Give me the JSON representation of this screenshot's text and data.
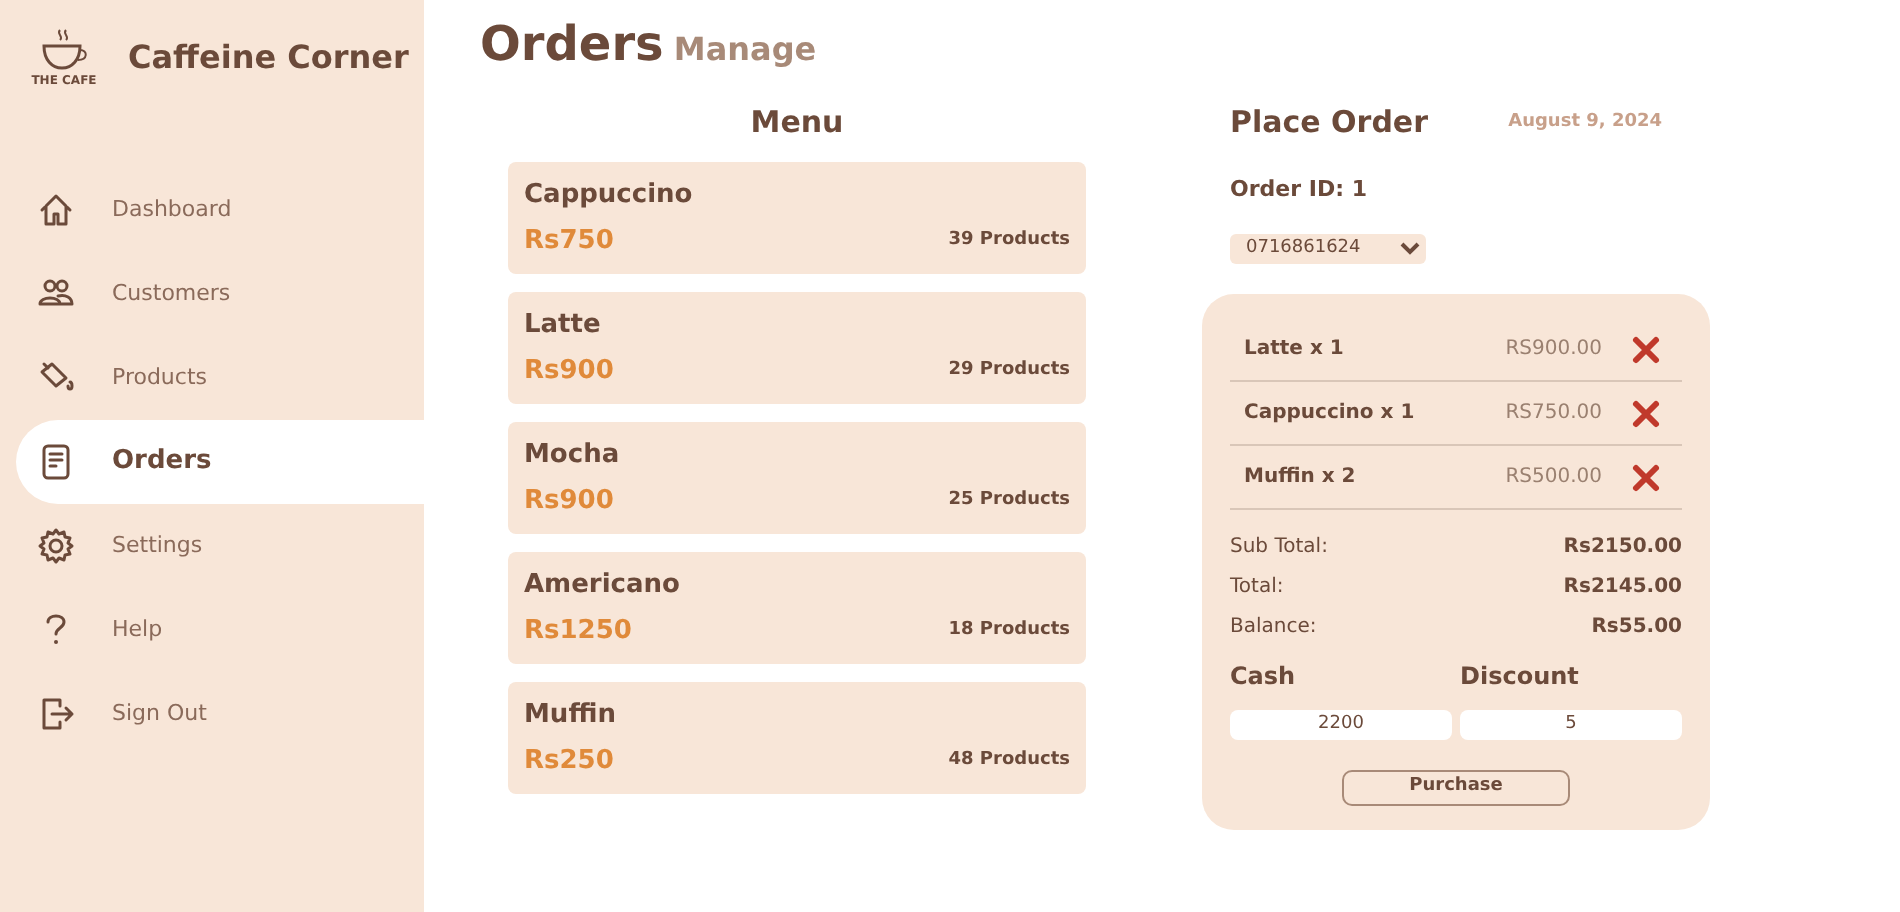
{
  "brand": {
    "logo_text": "THE CAFE",
    "name": "Caffeine Corner"
  },
  "sidebar": {
    "items": [
      {
        "label": "Dashboard",
        "selected": false
      },
      {
        "label": "Customers",
        "selected": false
      },
      {
        "label": "Products",
        "selected": false
      },
      {
        "label": "Orders",
        "selected": true
      },
      {
        "label": "Settings",
        "selected": false
      },
      {
        "label": "Help",
        "selected": false
      },
      {
        "label": "Sign Out",
        "selected": false
      }
    ]
  },
  "page": {
    "title": "Orders",
    "subtitle": "Manage"
  },
  "menu": {
    "heading": "Menu",
    "items": [
      {
        "name": "Cappuccino",
        "price": "Rs750",
        "stock": "39 Products"
      },
      {
        "name": "Latte",
        "price": "Rs900",
        "stock": "29 Products"
      },
      {
        "name": "Mocha",
        "price": "Rs900",
        "stock": "25 Products"
      },
      {
        "name": "Americano",
        "price": "Rs1250",
        "stock": "18 Products"
      },
      {
        "name": "Muffin",
        "price": "Rs250",
        "stock": "48 Products"
      }
    ]
  },
  "order": {
    "heading": "Place Order",
    "date": "August 9, 2024",
    "order_id": "Order ID: 1",
    "customer": "0716861624",
    "lines": [
      {
        "item": "Latte x 1",
        "amount": "RS900.00"
      },
      {
        "item": "Cappuccino x 1",
        "amount": "RS750.00"
      },
      {
        "item": "Muffin x 2",
        "amount": "RS500.00"
      }
    ],
    "totals": [
      {
        "label": "Sub Total:",
        "value": "Rs2150.00"
      },
      {
        "label": "Total:",
        "value": "Rs2145.00"
      },
      {
        "label": "Balance:",
        "value": "Rs55.00"
      }
    ],
    "cash": {
      "label": "Cash",
      "value": "2200"
    },
    "discount": {
      "label": "Discount",
      "value": "5"
    },
    "button": "Purchase"
  }
}
